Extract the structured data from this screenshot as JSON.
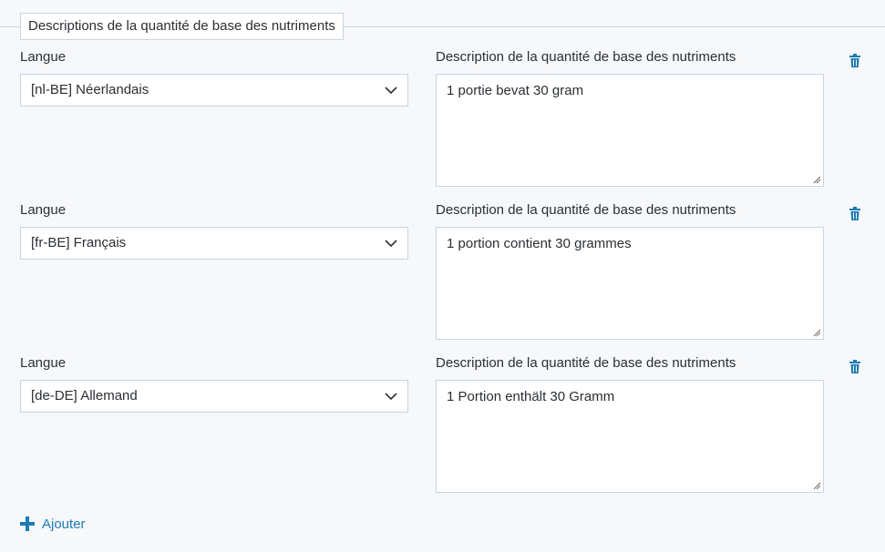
{
  "legend": "Descriptions de la quantité de base des nutriments",
  "rows": [
    {
      "lang_label": "Langue",
      "lang_value": "[nl-BE] Néerlandais",
      "desc_label": "Description de la quantité de base des nutriments",
      "desc_value": "1 portie bevat 30 gram"
    },
    {
      "lang_label": "Langue",
      "lang_value": "[fr-BE] Français",
      "desc_label": "Description de la quantité de base des nutriments",
      "desc_value": "1 portion contient 30 grammes"
    },
    {
      "lang_label": "Langue",
      "lang_value": "[de-DE] Allemand",
      "desc_label": "Description de la quantité de base des nutriments",
      "desc_value": "1 Portion enthält 30 Gramm"
    }
  ],
  "add_label": "Ajouter",
  "colors": {
    "accent": "#1f7bb5",
    "border": "#c9d4de",
    "background": "#f7f8fa"
  },
  "icons": {
    "delete": "trash-icon",
    "dropdown": "chevron-down-icon",
    "add": "plus-icon"
  }
}
